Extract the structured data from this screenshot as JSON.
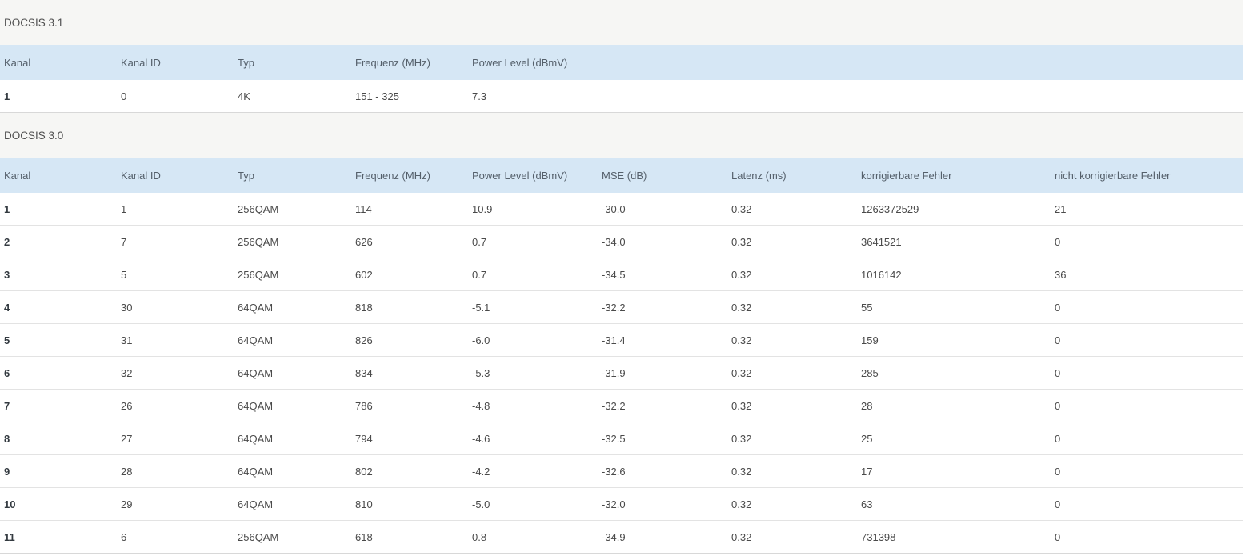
{
  "docsis31": {
    "title": "DOCSIS 3.1",
    "headers": [
      "Kanal",
      "Kanal ID",
      "Typ",
      "Frequenz (MHz)",
      "Power Level (dBmV)"
    ],
    "rows": [
      [
        "1",
        "0",
        "4K",
        "151 - 325",
        "7.3"
      ]
    ]
  },
  "docsis30": {
    "title": "DOCSIS 3.0",
    "headers": [
      "Kanal",
      "Kanal ID",
      "Typ",
      "Frequenz (MHz)",
      "Power Level (dBmV)",
      "MSE (dB)",
      "Latenz (ms)",
      "korrigierbare Fehler",
      "nicht korrigierbare Fehler"
    ],
    "rows": [
      [
        "1",
        "1",
        "256QAM",
        "114",
        "10.9",
        "-30.0",
        "0.32",
        "1263372529",
        "21"
      ],
      [
        "2",
        "7",
        "256QAM",
        "626",
        "0.7",
        "-34.0",
        "0.32",
        "3641521",
        "0"
      ],
      [
        "3",
        "5",
        "256QAM",
        "602",
        "0.7",
        "-34.5",
        "0.32",
        "1016142",
        "36"
      ],
      [
        "4",
        "30",
        "64QAM",
        "818",
        "-5.1",
        "-32.2",
        "0.32",
        "55",
        "0"
      ],
      [
        "5",
        "31",
        "64QAM",
        "826",
        "-6.0",
        "-31.4",
        "0.32",
        "159",
        "0"
      ],
      [
        "6",
        "32",
        "64QAM",
        "834",
        "-5.3",
        "-31.9",
        "0.32",
        "285",
        "0"
      ],
      [
        "7",
        "26",
        "64QAM",
        "786",
        "-4.8",
        "-32.2",
        "0.32",
        "28",
        "0"
      ],
      [
        "8",
        "27",
        "64QAM",
        "794",
        "-4.6",
        "-32.5",
        "0.32",
        "25",
        "0"
      ],
      [
        "9",
        "28",
        "64QAM",
        "802",
        "-4.2",
        "-32.6",
        "0.32",
        "17",
        "0"
      ],
      [
        "10",
        "29",
        "64QAM",
        "810",
        "-5.0",
        "-32.0",
        "0.32",
        "63",
        "0"
      ],
      [
        "11",
        "6",
        "256QAM",
        "618",
        "0.8",
        "-34.9",
        "0.32",
        "731398",
        "0"
      ]
    ]
  }
}
